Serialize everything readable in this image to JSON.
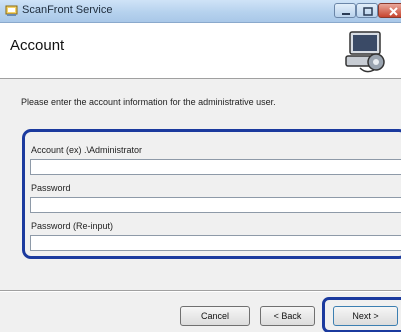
{
  "window": {
    "title": "ScanFront Service",
    "icon": "app-icon"
  },
  "header": {
    "title": "Account",
    "icon": "computer-settings-icon"
  },
  "instruction": "Please enter the account information for the administrative user.",
  "form": {
    "account": {
      "label": "Account (ex) .\\Administrator",
      "value": ""
    },
    "password": {
      "label": "Password",
      "value": ""
    },
    "password_reinput": {
      "label": "Password (Re-input)",
      "value": ""
    }
  },
  "buttons": {
    "cancel": "Cancel",
    "back": "< Back",
    "next": "Next >"
  },
  "colors": {
    "highlight": "#1b3a9e",
    "titlebar": "#b6d2ee"
  }
}
